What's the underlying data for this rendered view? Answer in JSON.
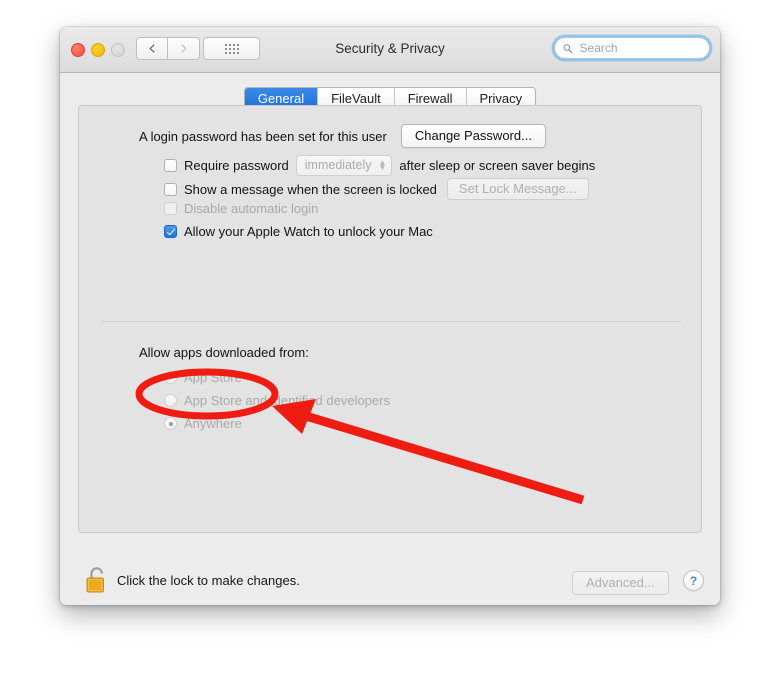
{
  "window": {
    "title": "Security & Privacy",
    "traffic_lights": [
      "close",
      "minimize",
      "zoom"
    ],
    "nav": {
      "back": "back-arrow",
      "forward": "forward-arrow",
      "show_all": "grid-icon"
    }
  },
  "search": {
    "placeholder": "Search",
    "value": "",
    "icon": "search-icon"
  },
  "tabs": [
    {
      "label": "General",
      "active": true
    },
    {
      "label": "FileVault",
      "active": false
    },
    {
      "label": "Firewall",
      "active": false
    },
    {
      "label": "Privacy",
      "active": false
    }
  ],
  "general": {
    "password_status": "A login password has been set for this user",
    "change_password_button": "Change Password...",
    "checkboxes": [
      {
        "label": "Require password",
        "checked": false,
        "enabled": true,
        "popup_value": "immediately",
        "suffix": "after sleep or screen saver begins"
      },
      {
        "label": "Show a message when the screen is locked",
        "checked": false,
        "enabled": true,
        "button": "Set Lock Message...",
        "button_enabled": false
      },
      {
        "label": "Disable automatic login",
        "checked": false,
        "enabled": false
      },
      {
        "label": "Allow your Apple Watch to unlock your Mac",
        "checked": true,
        "enabled": true
      }
    ],
    "download_section": {
      "heading": "Allow apps downloaded from:",
      "options": [
        {
          "label": "App Store",
          "selected": false,
          "enabled": false
        },
        {
          "label": "App Store and identified developers",
          "selected": false,
          "enabled": false
        },
        {
          "label": "Anywhere",
          "selected": true,
          "enabled": false
        }
      ]
    }
  },
  "footer": {
    "lock_icon": "open-padlock-icon",
    "lock_text": "Click the lock to make changes.",
    "advanced_button": "Advanced...",
    "advanced_enabled": false,
    "help_button": "?"
  },
  "annotation": {
    "highlight_target": "Anywhere",
    "shape": "ellipse-and-arrow",
    "color": "#ee1c11"
  }
}
